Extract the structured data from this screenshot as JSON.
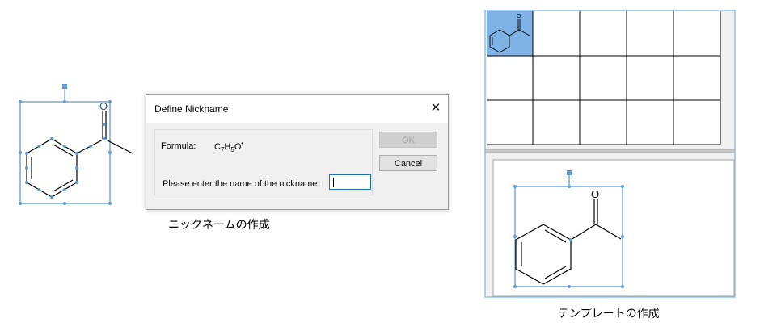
{
  "dialog": {
    "title": "Define Nickname",
    "close_glyph": "✕",
    "formula_label": "Formula:",
    "formula": {
      "c": "C",
      "c_count": "7",
      "h": "H",
      "h_count": "5",
      "o": "O",
      "radical": "•"
    },
    "nickname_prompt": "Please enter the name of the nickname:",
    "nickname_value": "",
    "ok_label": "OK",
    "cancel_label": "Cancel"
  },
  "molecule": {
    "oxygen_label": "O"
  },
  "captions": {
    "left": "ニックネームの作成",
    "right": "テンプレートの作成"
  },
  "template_grid": {
    "rows": 3,
    "cols": 5,
    "selected_cell": [
      0,
      0
    ]
  },
  "colors": {
    "selection": "#5b9bd5",
    "selected_cell_bg": "#7fb2e5",
    "panel_border": "#8fc3ea",
    "focus_border": "#1f6fb5"
  }
}
